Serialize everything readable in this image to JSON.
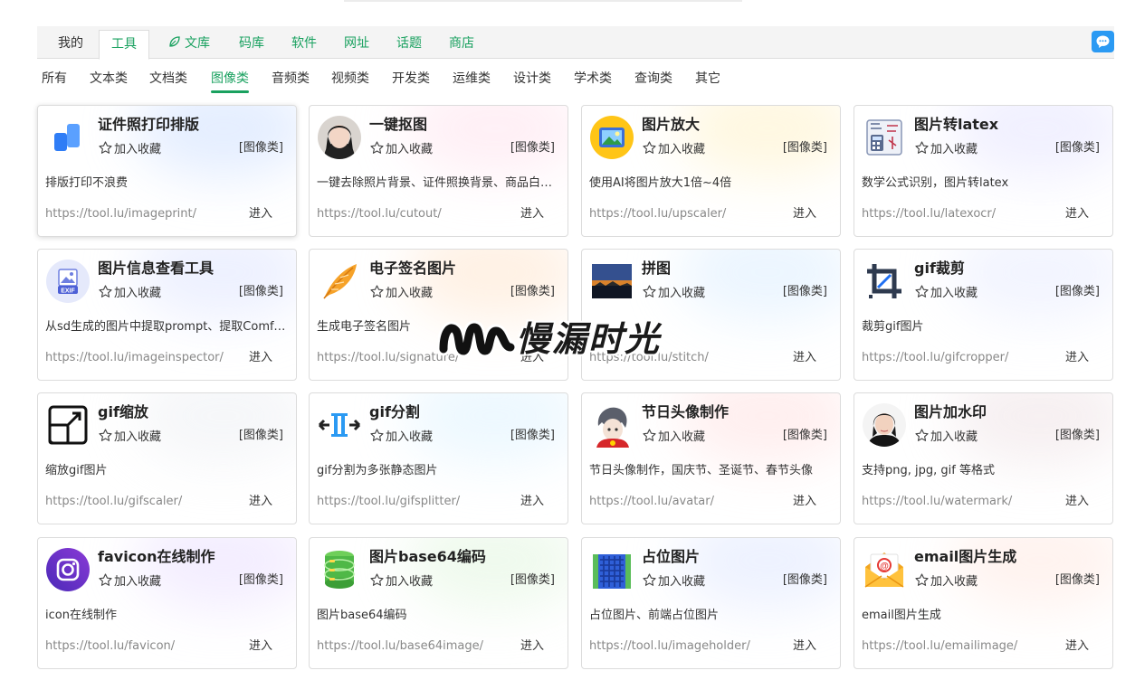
{
  "nav": {
    "tabs": [
      {
        "label": "我的"
      },
      {
        "label": "工具"
      },
      {
        "label": "文库"
      },
      {
        "label": "码库"
      },
      {
        "label": "软件"
      },
      {
        "label": "网址"
      },
      {
        "label": "话题"
      },
      {
        "label": "商店"
      }
    ]
  },
  "subnav": {
    "tabs": [
      {
        "label": "所有"
      },
      {
        "label": "文本类"
      },
      {
        "label": "文档类"
      },
      {
        "label": "图像类"
      },
      {
        "label": "音频类"
      },
      {
        "label": "视频类"
      },
      {
        "label": "开发类"
      },
      {
        "label": "运维类"
      },
      {
        "label": "设计类"
      },
      {
        "label": "学术类"
      },
      {
        "label": "查询类"
      },
      {
        "label": "其它"
      }
    ]
  },
  "favorite_label": "加入收藏",
  "enter_label": "进入",
  "cards": [
    {
      "title": "证件照打印排版",
      "category": "[图像类]",
      "desc": "排版打印不浪费",
      "url": "https://tool.lu/imageprint/",
      "icon": "imageprint-icon"
    },
    {
      "title": "一键抠图",
      "category": "[图像类]",
      "desc": "一键去除照片背景、证件照换背景、商品白底图",
      "url": "https://tool.lu/cutout/",
      "icon": "cutout-portrait-icon"
    },
    {
      "title": "图片放大",
      "category": "[图像类]",
      "desc": "使用AI将图片放大1倍~4倍",
      "url": "https://tool.lu/upscaler/",
      "icon": "upscaler-icon"
    },
    {
      "title": "图片转latex",
      "category": "[图像类]",
      "desc": "数学公式识别，图片转latex",
      "url": "https://tool.lu/latexocr/",
      "icon": "latex-math-icon"
    },
    {
      "title": "图片信息查看工具",
      "category": "[图像类]",
      "desc": "从sd生成的图片中提取prompt、提取ComfyUI工作流",
      "url": "https://tool.lu/imageinspector/",
      "icon": "exif-icon"
    },
    {
      "title": "电子签名图片",
      "category": "[图像类]",
      "desc": "生成电子签名图片",
      "url": "https://tool.lu/signature/",
      "icon": "feather-icon"
    },
    {
      "title": "拼图",
      "category": "[图像类]",
      "desc": "",
      "url": "https://tool.lu/stitch/",
      "icon": "stitch-photo-icon"
    },
    {
      "title": "gif裁剪",
      "category": "[图像类]",
      "desc": "裁剪gif图片",
      "url": "https://tool.lu/gifcropper/",
      "icon": "crop-icon"
    },
    {
      "title": "gif缩放",
      "category": "[图像类]",
      "desc": "缩放gif图片",
      "url": "https://tool.lu/gifscaler/",
      "icon": "resize-icon"
    },
    {
      "title": "gif分割",
      "category": "[图像类]",
      "desc": "gif分割为多张静态图片",
      "url": "https://tool.lu/gifsplitter/",
      "icon": "split-icon"
    },
    {
      "title": "节日头像制作",
      "category": "[图像类]",
      "desc": "节日头像制作，国庆节、圣诞节、春节头像",
      "url": "https://tool.lu/avatar/",
      "icon": "avatar-anime-icon"
    },
    {
      "title": "图片加水印",
      "category": "[图像类]",
      "desc": "支持png, jpg, gif 等格式",
      "url": "https://tool.lu/watermark/",
      "icon": "watermark-portrait-icon"
    },
    {
      "title": "favicon在线制作",
      "category": "[图像类]",
      "desc": "icon在线制作",
      "url": "https://tool.lu/favicon/",
      "icon": "instagram-style-icon"
    },
    {
      "title": "图片base64编码",
      "category": "[图像类]",
      "desc": "图片base64编码",
      "url": "https://tool.lu/base64image/",
      "icon": "database-icon"
    },
    {
      "title": "占位图片",
      "category": "[图像类]",
      "desc": "占位图片、前端占位图片",
      "url": "https://tool.lu/imageholder/",
      "icon": "placeholder-grid-icon"
    },
    {
      "title": "email图片生成",
      "category": "[图像类]",
      "desc": "email图片生成",
      "url": "https://tool.lu/emailimage/",
      "icon": "email-envelope-icon"
    }
  ],
  "watermark": {
    "text": "慢漏时光"
  },
  "colors": {
    "accent": "#19a15f",
    "chat": "#2b9af3"
  }
}
